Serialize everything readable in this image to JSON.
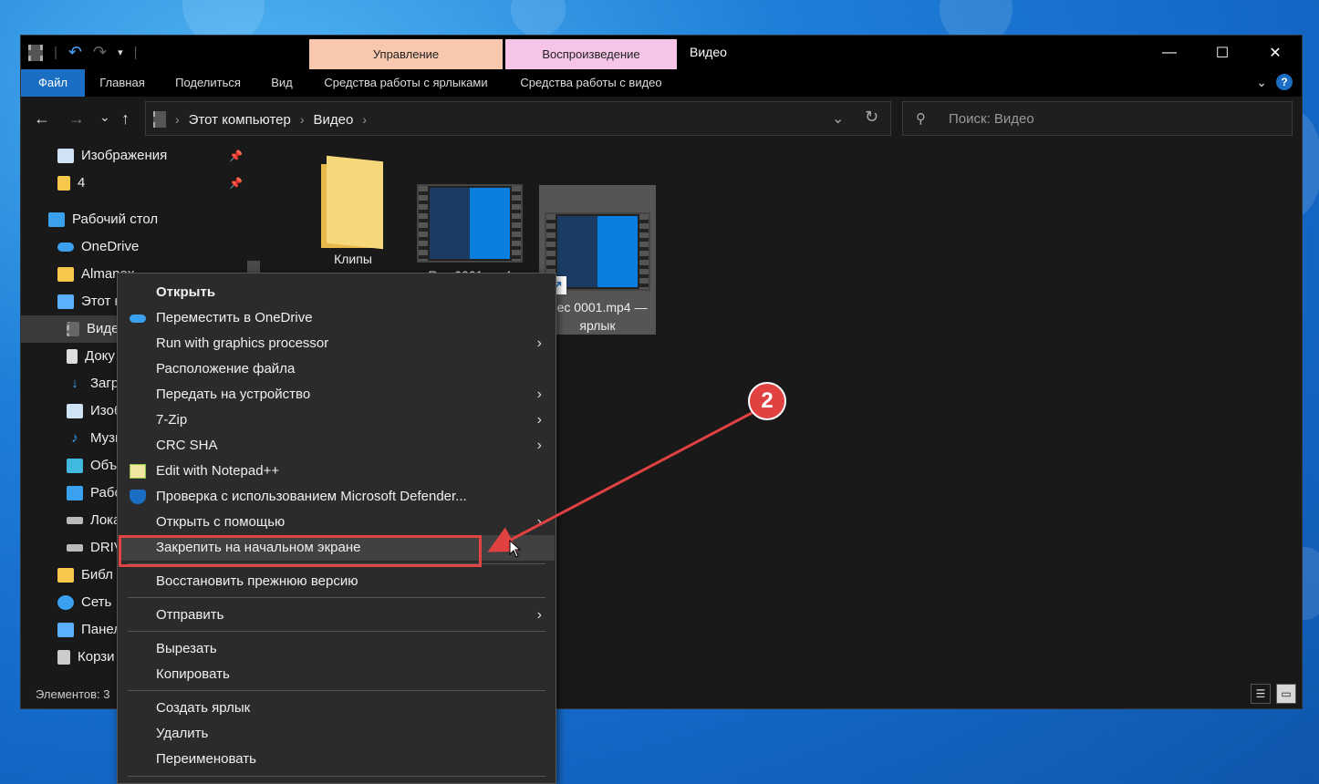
{
  "window": {
    "title": "Видео",
    "quick_access_icons": [
      "film-icon",
      "undo-icon",
      "redo-icon",
      "dropdown-icon"
    ],
    "context_tabs": {
      "manage": "Управление",
      "play": "Воспроизведение"
    },
    "controls": {
      "minimize": "—",
      "maximize": "☐",
      "close": "✕"
    }
  },
  "ribbon": {
    "tabs": [
      "Файл",
      "Главная",
      "Поделиться",
      "Вид",
      "Средства работы с ярлыками",
      "Средства работы с видео"
    ],
    "active_tab": "Файл",
    "help": "?"
  },
  "address_bar": {
    "crumbs": [
      "Этот компьютер",
      "Видео"
    ],
    "search_placeholder": "Поиск: Видео",
    "nav": {
      "back": "←",
      "forward": "→",
      "recent": "⌄",
      "up": "↑"
    }
  },
  "sidebar": {
    "items": [
      {
        "label": "Изображения",
        "icon": "pictures-icon",
        "pinned": true
      },
      {
        "label": "4",
        "icon": "folder-icon",
        "pinned": true
      },
      {
        "label": "Рабочий стол",
        "icon": "desktop-icon"
      },
      {
        "label": "OneDrive",
        "icon": "onedrive-icon"
      },
      {
        "label": "Almanex",
        "icon": "user-folder-icon"
      },
      {
        "label": "Этот к",
        "icon": "computer-icon"
      },
      {
        "label": "Виде",
        "icon": "videos-icon",
        "selected": true
      },
      {
        "label": "Доку",
        "icon": "documents-icon"
      },
      {
        "label": "Загр",
        "icon": "downloads-icon"
      },
      {
        "label": "Изоб",
        "icon": "pictures-icon"
      },
      {
        "label": "Музы",
        "icon": "music-icon"
      },
      {
        "label": "Объ",
        "icon": "3d-objects-icon"
      },
      {
        "label": "Рабо",
        "icon": "desktop-icon"
      },
      {
        "label": "Лока",
        "icon": "drive-icon"
      },
      {
        "label": "DRIV",
        "icon": "drive-icon"
      },
      {
        "label": "Библ",
        "icon": "libraries-icon"
      },
      {
        "label": "Сеть",
        "icon": "network-icon"
      },
      {
        "label": "Панел",
        "icon": "control-panel-icon"
      },
      {
        "label": "Корзи",
        "icon": "recycle-bin-icon"
      }
    ]
  },
  "files": [
    {
      "name": "Клипы",
      "type": "folder"
    },
    {
      "name": "Rec 0001.mp4",
      "type": "video"
    },
    {
      "name": "Rec 0001.mp4 — ярлык",
      "type": "shortcut",
      "selected": true
    }
  ],
  "status": {
    "text": "Элементов: 3"
  },
  "context_menu": {
    "items": [
      {
        "label": "Открыть",
        "bold": true
      },
      {
        "label": "Переместить в OneDrive",
        "icon": "onedrive-icon"
      },
      {
        "label": "Run with graphics processor",
        "submenu": true
      },
      {
        "label": "Расположение файла"
      },
      {
        "label": "Передать на устройство",
        "submenu": true
      },
      {
        "label": "7-Zip",
        "submenu": true
      },
      {
        "label": "CRC SHA",
        "submenu": true
      },
      {
        "label": "Edit with Notepad++",
        "icon": "notepad-icon"
      },
      {
        "label": "Проверка с использованием Microsoft Defender...",
        "icon": "defender-shield-icon"
      },
      {
        "label": "Открыть с помощью",
        "submenu": true
      },
      {
        "label": "Закрепить на начальном экране",
        "highlighted": true
      },
      {
        "label": "Восстановить прежнюю версию"
      },
      {
        "label": "Отправить",
        "submenu": true
      },
      {
        "label": "Вырезать"
      },
      {
        "label": "Копировать"
      },
      {
        "label": "Создать ярлык"
      },
      {
        "label": "Удалить"
      },
      {
        "label": "Переименовать"
      }
    ]
  },
  "annotation": {
    "badge": "2",
    "color": "#e04141"
  }
}
